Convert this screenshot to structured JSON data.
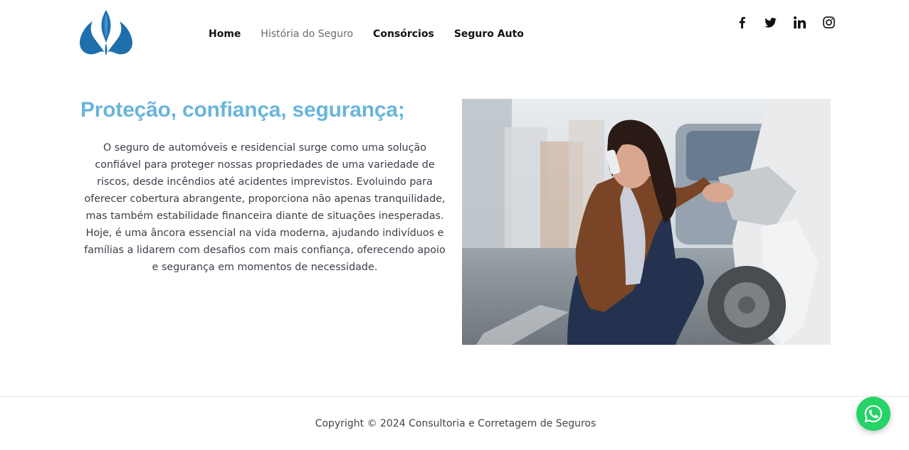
{
  "header": {
    "nav": [
      {
        "label": "Home",
        "active": false
      },
      {
        "label": "História do Seguro",
        "active": true
      },
      {
        "label": "Consórcios",
        "active": false
      },
      {
        "label": "Seguro Auto",
        "active": false
      }
    ],
    "social": [
      "facebook-icon",
      "twitter-icon",
      "linkedin-icon",
      "instagram-icon"
    ],
    "logo_color": "#1f6fad"
  },
  "hero": {
    "title": "Proteção, confiança, segurança;",
    "paragraph": "O seguro de automóveis e residencial surge como uma solução confiável para proteger nossas propriedades de uma variedade de riscos, desde incêndios até acidentes imprevistos. Evoluindo para oferecer cobertura abrangente, proporciona não apenas tranquilidade, mas também estabilidade financeira diante de situações inesperadas. Hoje, é uma âncora essencial na vida moderna, ajudando indivíduos e famílias a lidarem com desafios com mais confiança, oferecendo apoio e segurança em momentos de necessidade.",
    "title_color": "#6ab5da"
  },
  "footer": {
    "copyright": "Copyright © 2024 Consultoria e Corretagem de Seguros"
  },
  "whatsapp": {
    "icon": "whatsapp-icon",
    "color": "#25d366"
  }
}
